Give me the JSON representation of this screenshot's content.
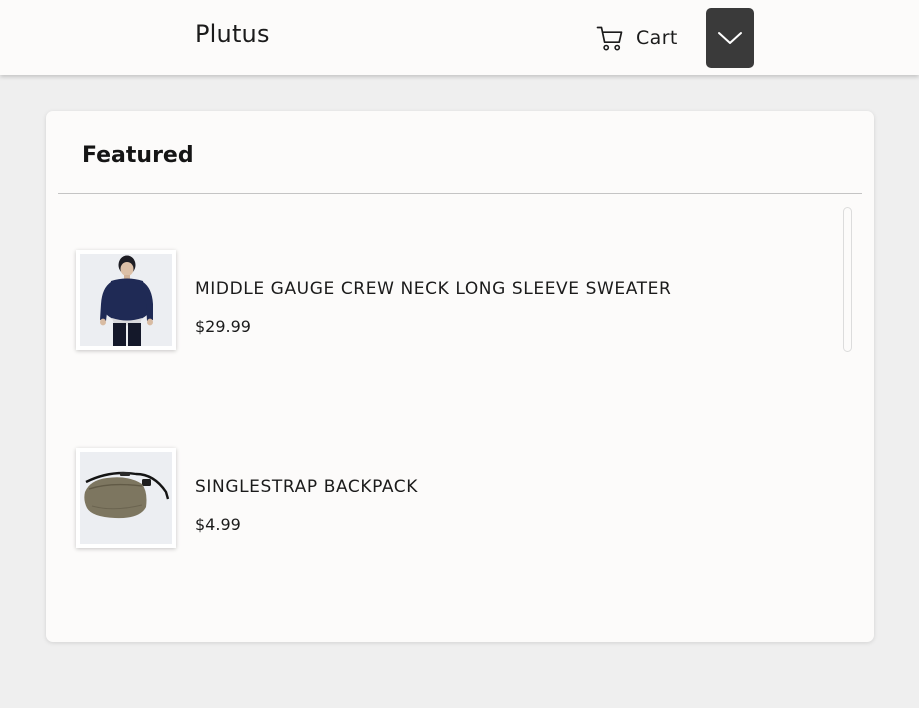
{
  "header": {
    "brand": "Plutus",
    "cart_label": "Cart",
    "cart_icon": "cart-icon",
    "menu_icon": "chevron-down-icon",
    "menu_button_color": "#3a3a3a"
  },
  "featured": {
    "title": "Featured",
    "products": [
      {
        "name": "MIDDLE GAUGE CREW NECK LONG SLEEVE SWEATER",
        "price": "$29.99",
        "image": "sweater-photo"
      },
      {
        "name": "SINGLESTRAP BACKPACK",
        "price": "$4.99",
        "image": "belt-bag-photo"
      }
    ]
  },
  "colors": {
    "page_background": "#efefef",
    "surface": "#fcfbfa",
    "text": "#1b1b1b"
  }
}
